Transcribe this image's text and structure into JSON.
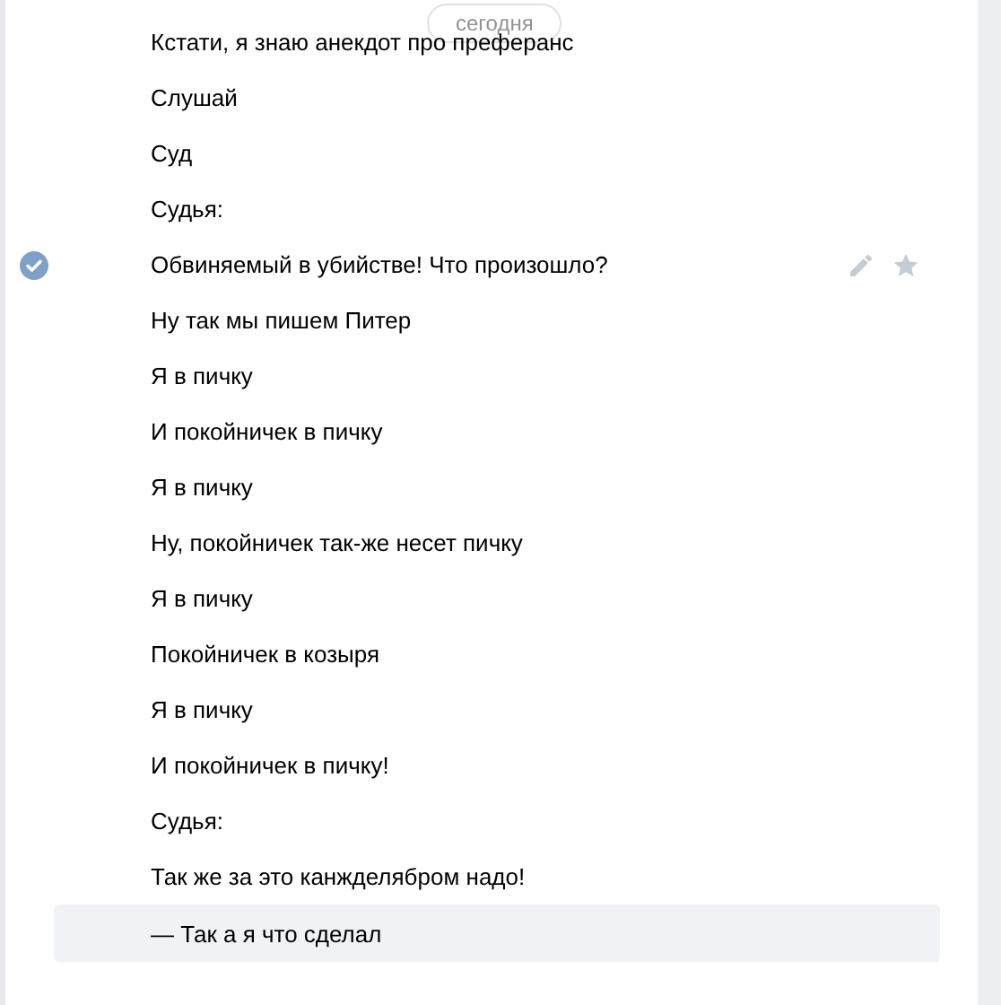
{
  "date_badge": "сегодня",
  "messages": [
    {
      "text": "Кстати, я знаю анекдот про преферанс",
      "selected": false,
      "highlighted": false
    },
    {
      "text": "Слушай",
      "selected": false,
      "highlighted": false
    },
    {
      "text": "Суд",
      "selected": false,
      "highlighted": false
    },
    {
      "text": "Судья:",
      "selected": false,
      "highlighted": false
    },
    {
      "text": "Обвиняемый в убийстве! Что произошло?",
      "selected": true,
      "highlighted": false
    },
    {
      "text": "Ну так мы пишем Питер",
      "selected": false,
      "highlighted": false
    },
    {
      "text": "Я в пичку",
      "selected": false,
      "highlighted": false
    },
    {
      "text": "И покойничек в пичку",
      "selected": false,
      "highlighted": false
    },
    {
      "text": "Я в пичку",
      "selected": false,
      "highlighted": false
    },
    {
      "text": "Ну, покойничек так-же несет пичку",
      "selected": false,
      "highlighted": false
    },
    {
      "text": "Я в пичку",
      "selected": false,
      "highlighted": false
    },
    {
      "text": "Покойничек в козыря",
      "selected": false,
      "highlighted": false
    },
    {
      "text": "Я в пичку",
      "selected": false,
      "highlighted": false
    },
    {
      "text": "И покойничек в пичку!",
      "selected": false,
      "highlighted": false
    },
    {
      "text": "Судья:",
      "selected": false,
      "highlighted": false
    },
    {
      "text": "Так же за это канжделябром надо!",
      "selected": false,
      "highlighted": false
    },
    {
      "text": "— Так а я что сделал",
      "selected": false,
      "highlighted": true
    }
  ]
}
